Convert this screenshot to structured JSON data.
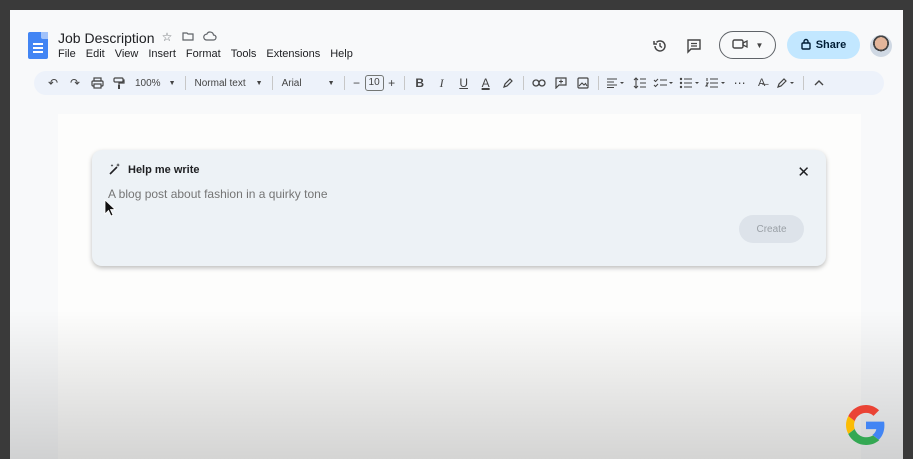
{
  "header": {
    "title": "Job Description",
    "menu": [
      "File",
      "Edit",
      "View",
      "Insert",
      "Format",
      "Tools",
      "Extensions",
      "Help"
    ],
    "share_label": "Share"
  },
  "toolbar": {
    "zoom": "100%",
    "style": "Normal text",
    "font": "Arial",
    "font_size": "10"
  },
  "help_me_write": {
    "title": "Help me write",
    "placeholder": "A blog post about fashion in a quirky tone",
    "create_label": "Create"
  },
  "colors": {
    "docs_blue": "#4285f4",
    "share_bg": "#c2e7ff",
    "card_bg": "#edf2f6"
  },
  "icons": [
    "undo-icon",
    "redo-icon",
    "print-icon",
    "paint-format-icon",
    "bold-icon",
    "italic-icon",
    "underline-icon",
    "text-color-icon",
    "highlight-icon",
    "link-icon",
    "comment-icon",
    "image-icon",
    "align-icon",
    "line-spacing-icon",
    "checklist-icon",
    "bullet-list-icon",
    "numbered-list-icon",
    "more-icon",
    "spellcheck-icon",
    "edit-mode-icon",
    "collapse-icon",
    "history-icon",
    "comments-icon",
    "meet-icon",
    "lock-icon",
    "star-icon",
    "move-icon",
    "cloud-icon",
    "wand-icon",
    "close-icon",
    "google-logo"
  ]
}
